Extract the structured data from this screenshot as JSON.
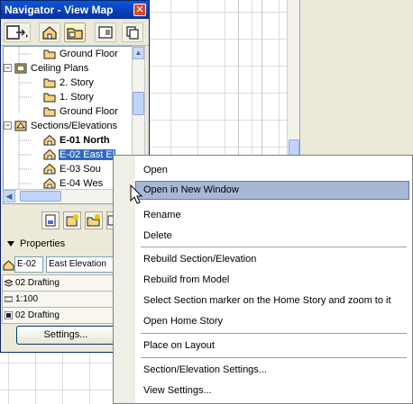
{
  "navigator": {
    "title": "Navigator - View Map",
    "close_symbol": "✕",
    "toolbar_icons": [
      "publish-icon",
      "project-map-icon",
      "view-map-icon",
      "layout-book-icon",
      "publisher-sets-icon"
    ],
    "tree": [
      {
        "label": "Ground Floor",
        "icon": "folder-icon",
        "indent": 2
      },
      {
        "label": "Ceiling Plans",
        "icon": "ceiling-plan-icon",
        "indent": 1,
        "expander": "−"
      },
      {
        "label": "2. Story",
        "icon": "folder-icon",
        "indent": 2
      },
      {
        "label": "1. Story",
        "icon": "folder-icon",
        "indent": 2
      },
      {
        "label": "Ground Floor",
        "icon": "folder-icon",
        "indent": 2
      },
      {
        "label": "Sections/Elevations",
        "icon": "sections-icon",
        "indent": 1,
        "expander": "−"
      },
      {
        "label": "E-01 North",
        "icon": "house-icon",
        "indent": 2,
        "bold": true
      },
      {
        "label": "E-02 East El",
        "icon": "house-icon",
        "indent": 2,
        "selected": true
      },
      {
        "label": "E-03 Sou",
        "icon": "house-icon",
        "indent": 2
      },
      {
        "label": "E-04 Wes",
        "icon": "house-icon",
        "indent": 2
      }
    ],
    "scroll_up": "▲",
    "scroll_down": "▼",
    "scroll_left": "◀",
    "scroll_right": "▶",
    "properties": {
      "header": "Properties",
      "id_value": "E-02",
      "name_value": "East Elevation",
      "rows": [
        "02 Drafting",
        "1:100",
        "02 Drafting"
      ],
      "settings_label": "Settings..."
    }
  },
  "context_menu": {
    "items": [
      {
        "label": "Open"
      },
      {
        "label": "Open in New Window",
        "highlighted": true
      },
      {
        "label": "Rename"
      },
      {
        "label": "Delete"
      },
      {
        "label": "Rebuild Section/Elevation"
      },
      {
        "label": "Rebuild from Model"
      },
      {
        "label": "Select Section marker on the Home Story and zoom to it"
      },
      {
        "label": "Open Home Story"
      },
      {
        "label": "Place on Layout"
      },
      {
        "label": "Section/Elevation Settings..."
      },
      {
        "label": "View Settings..."
      }
    ]
  },
  "colors": {
    "titlebar": "#0a58d6",
    "selection": "#316ac5",
    "menu_highlight": "#a6b8d6",
    "panel_bg": "#ece9d8"
  }
}
